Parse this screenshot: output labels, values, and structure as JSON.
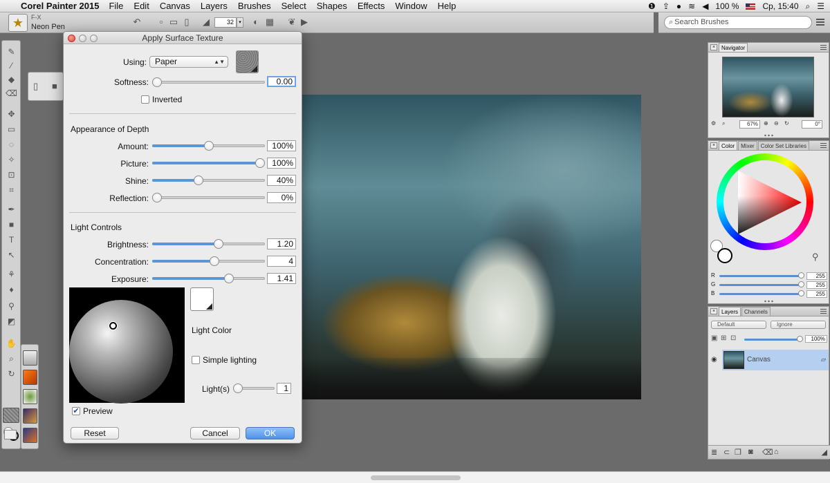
{
  "menubar": {
    "apple_icon": "apple-icon",
    "app_name": "Corel Painter 2015",
    "items": [
      "File",
      "Edit",
      "Canvas",
      "Layers",
      "Brushes",
      "Select",
      "Shapes",
      "Effects",
      "Window",
      "Help"
    ],
    "battery": "100 %",
    "clock": "Ср, 15:40"
  },
  "propbar": {
    "brush_category": "F-X",
    "brush_name": "Neon Pen",
    "size_value": "32"
  },
  "search": {
    "placeholder": "Search Brushes"
  },
  "dialog": {
    "title": "Apply Surface Texture",
    "using_label": "Using:",
    "using_value": "Paper",
    "softness_label": "Softness:",
    "softness_value": "0.00",
    "inverted_label": "Inverted",
    "inverted_checked": false,
    "depth_section": "Appearance of Depth",
    "amount_label": "Amount:",
    "amount_value": "100%",
    "picture_label": "Picture:",
    "picture_value": "100%",
    "shine_label": "Shine:",
    "shine_value": "40%",
    "reflection_label": "Reflection:",
    "reflection_value": "0%",
    "light_section": "Light Controls",
    "brightness_label": "Brightness:",
    "brightness_value": "1.20",
    "concentration_label": "Concentration:",
    "concentration_value": "4",
    "exposure_label": "Exposure:",
    "exposure_value": "1.41",
    "light_color_label": "Light Color",
    "simple_lighting_label": "Simple lighting",
    "simple_lighting_checked": false,
    "lights_label": "Light(s)",
    "lights_value": "1",
    "preview_label": "Preview",
    "preview_checked": true,
    "reset_label": "Reset",
    "cancel_label": "Cancel",
    "ok_label": "OK",
    "slider_levels": {
      "softness": 0.0,
      "amount": 0.5,
      "picture": 1.0,
      "shine": 0.4,
      "reflection": 0.0,
      "brightness": 0.6,
      "concentration": 0.56,
      "exposure": 0.7,
      "lights": 0.0
    }
  },
  "navigator": {
    "tab": "Navigator",
    "zoom": "67%",
    "rotation": "0°"
  },
  "color_panel": {
    "tabs": [
      "Color",
      "Mixer",
      "Color Set Libraries"
    ],
    "r_label": "R",
    "r_value": "255",
    "g_label": "G",
    "g_value": "255",
    "b_label": "B",
    "b_value": "255"
  },
  "layers_panel": {
    "tabs": [
      "Layers",
      "Channels"
    ],
    "composite_method": "Default",
    "preserve": "Ignore",
    "opacity": "100%",
    "layer_name": "Canvas"
  }
}
